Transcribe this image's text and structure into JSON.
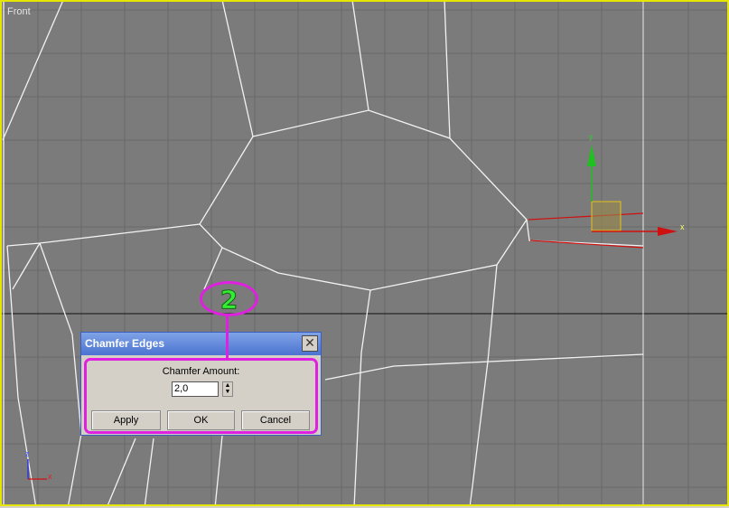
{
  "viewport": {
    "label": "Front",
    "gizmo_y_label": "y",
    "gizmo_x_label": "x",
    "corner_y_label": "z",
    "corner_x_label": "x"
  },
  "dialog": {
    "title": "Chamfer Edges",
    "close_glyph": "✕",
    "amount_label": "Chamfer Amount:",
    "amount_value": "2,0",
    "apply_label": "Apply",
    "ok_label": "OK",
    "cancel_label": "Cancel"
  },
  "annotation": {
    "step_number": "2"
  },
  "colors": {
    "viewport_bg": "#7b7b7b",
    "viewport_border": "#e6e600",
    "highlight": "#e020e0",
    "step_text": "#33ee33"
  }
}
